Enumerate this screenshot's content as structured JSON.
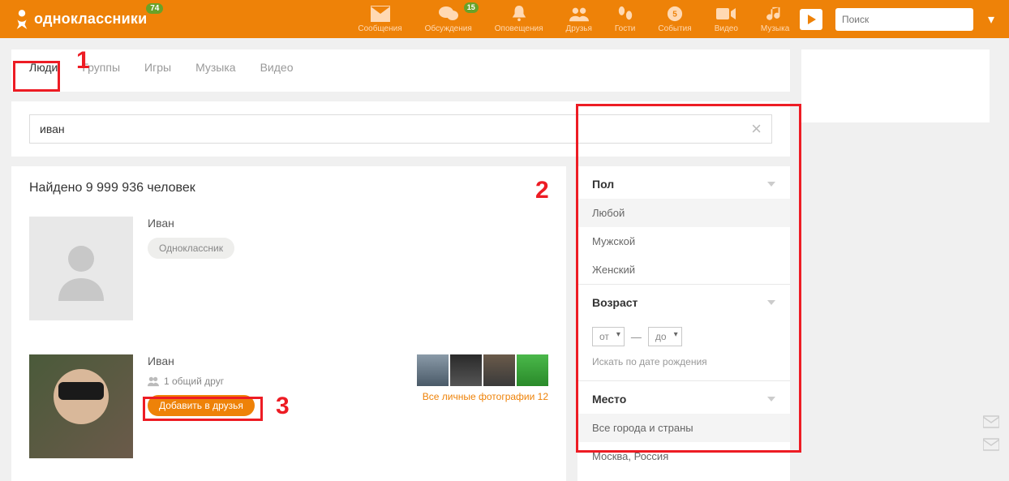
{
  "header": {
    "logo_text": "одноклассники",
    "logo_badge": "74",
    "nav": [
      {
        "id": "messages",
        "label": "Сообщения",
        "badge": null
      },
      {
        "id": "discussions",
        "label": "Обсуждения",
        "badge": "15"
      },
      {
        "id": "notifications",
        "label": "Оповещения",
        "badge": null
      },
      {
        "id": "friends",
        "label": "Друзья",
        "badge": null
      },
      {
        "id": "guests",
        "label": "Гости",
        "badge": null
      },
      {
        "id": "events",
        "label": "События",
        "badge": null
      },
      {
        "id": "video",
        "label": "Видео",
        "badge": null
      },
      {
        "id": "music",
        "label": "Музыка",
        "badge": null
      }
    ],
    "search_placeholder": "Поиск"
  },
  "tabs": [
    {
      "id": "people",
      "label": "Люди",
      "active": true
    },
    {
      "id": "groups",
      "label": "Группы",
      "active": false
    },
    {
      "id": "games",
      "label": "Игры",
      "active": false
    },
    {
      "id": "music",
      "label": "Музыка",
      "active": false
    },
    {
      "id": "video",
      "label": "Видео",
      "active": false
    }
  ],
  "search": {
    "value": "иван"
  },
  "results": {
    "heading": "Найдено 9 999 936 человек",
    "items": [
      {
        "name": "Иван",
        "tag": "Одноклассник",
        "has_photo": false
      },
      {
        "name": "Иван",
        "mutual": "1 общий друг",
        "add_label": "Добавить в друзья",
        "photos_link": "Все личные фотографии 12",
        "has_photo": true
      }
    ]
  },
  "filters": {
    "gender": {
      "title": "Пол",
      "options": [
        "Любой",
        "Мужской",
        "Женский"
      ],
      "selected": "Любой"
    },
    "age": {
      "title": "Возраст",
      "from": "от",
      "to": "до",
      "dash": "—",
      "birth_link": "Искать по дате рождения"
    },
    "place": {
      "title": "Место",
      "options": [
        "Все города и страны",
        "Москва, Россия"
      ],
      "selected": "Все города и страны"
    }
  },
  "annotations": {
    "n1": "1",
    "n2": "2",
    "n3": "3"
  }
}
